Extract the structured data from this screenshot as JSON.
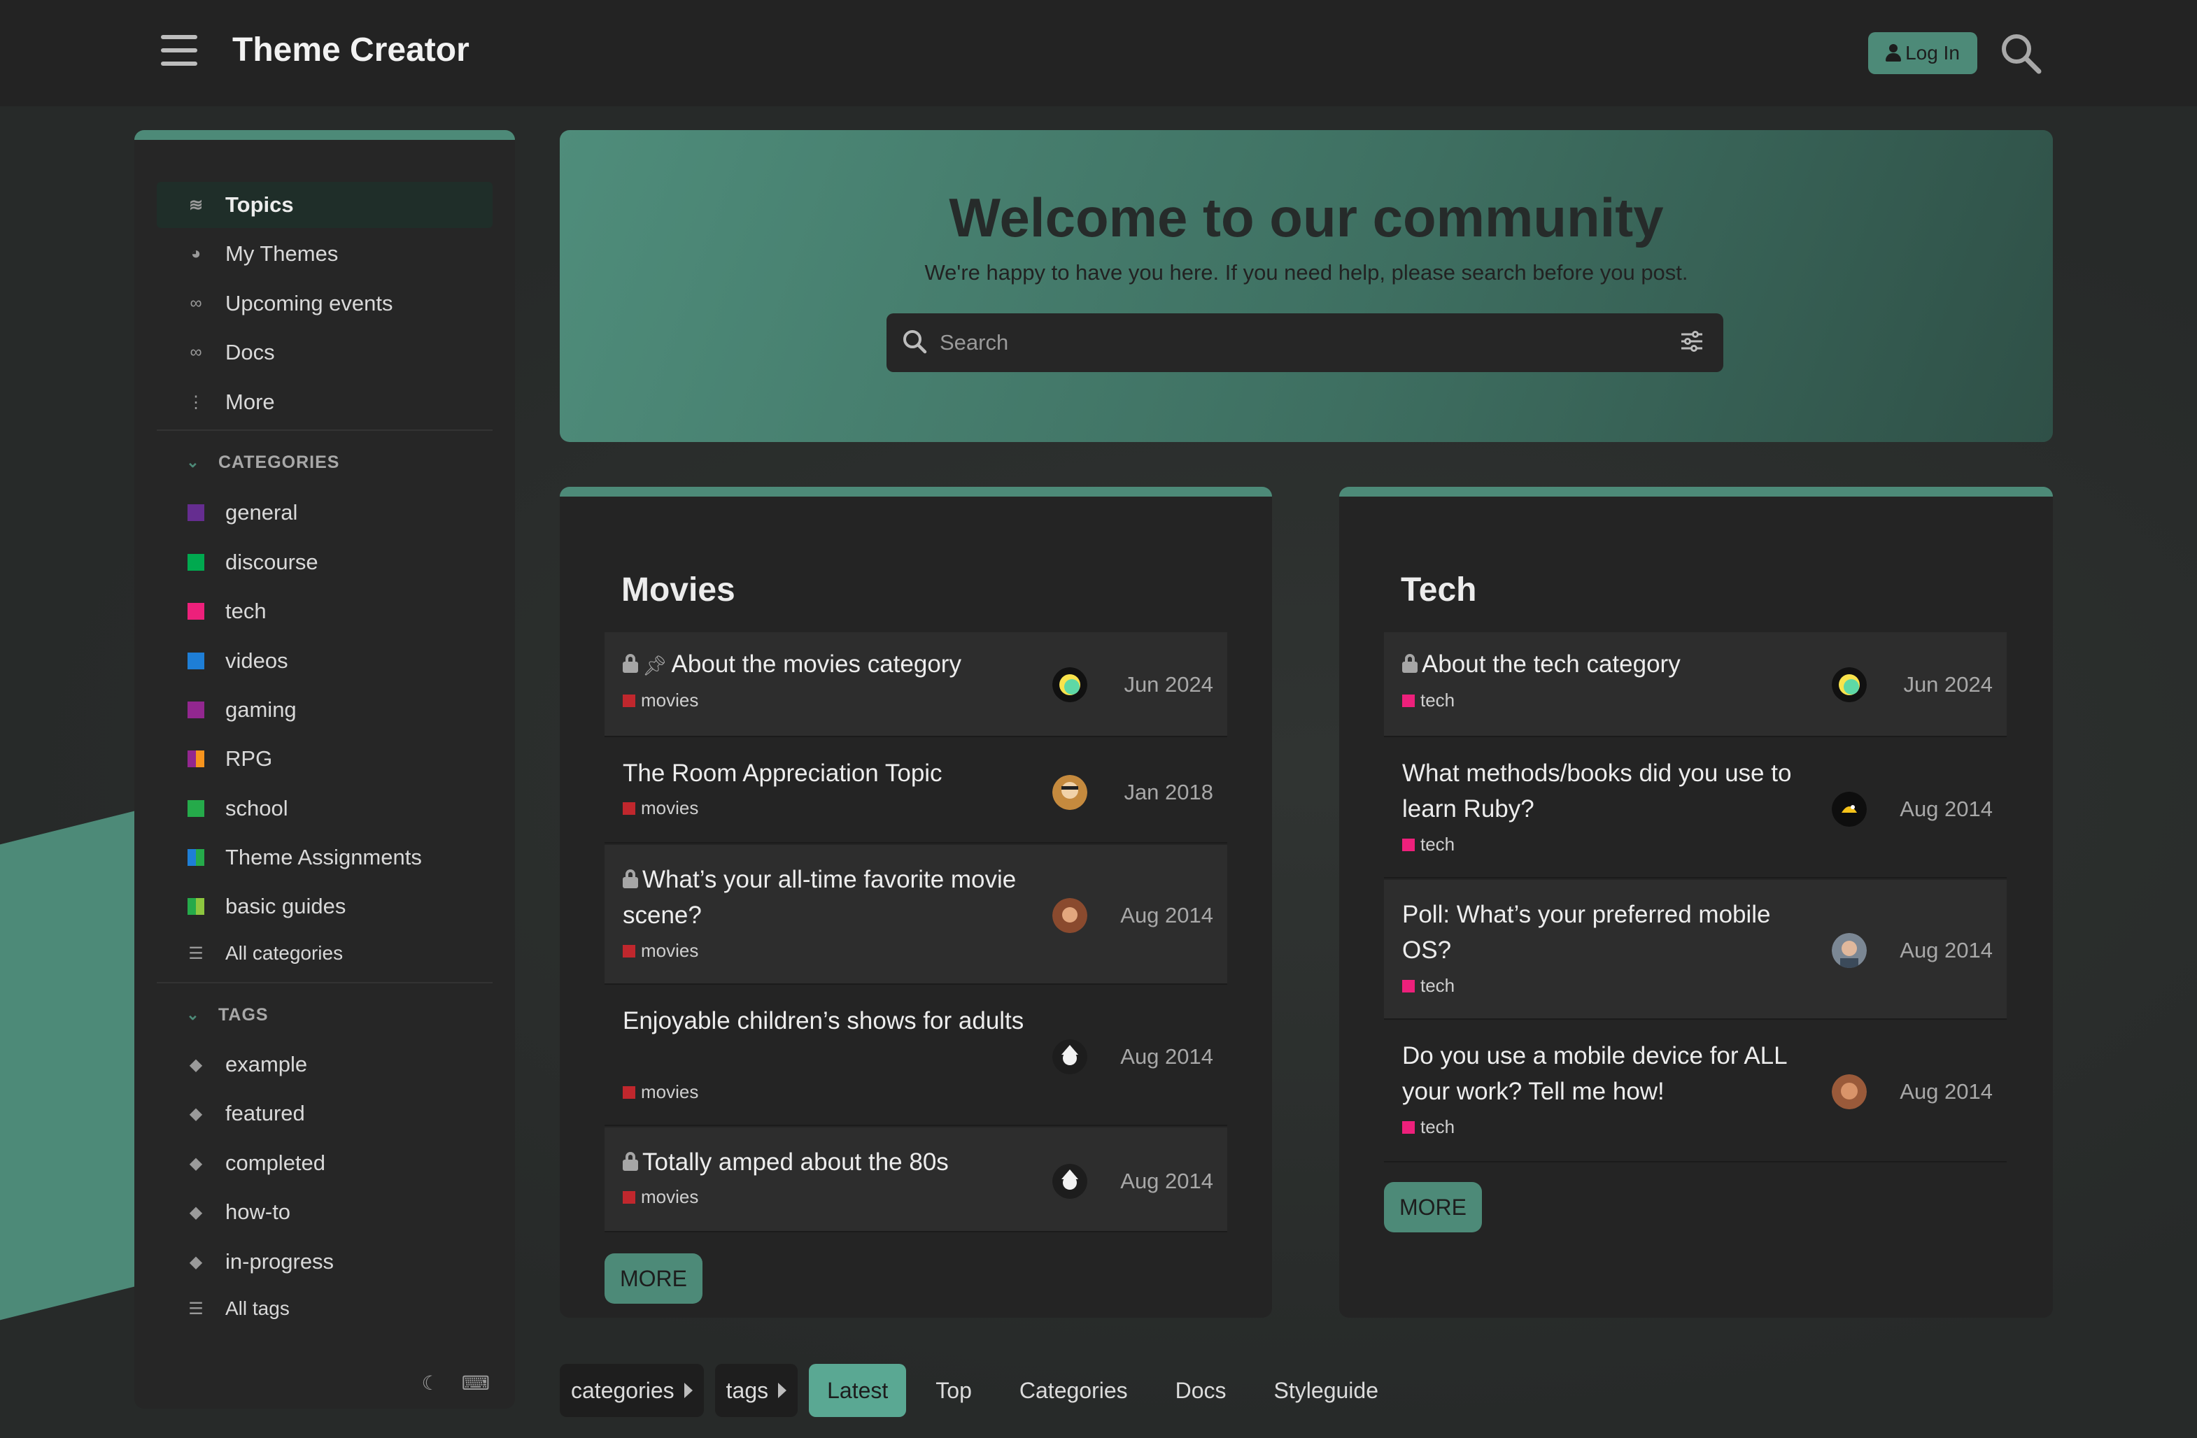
{
  "header": {
    "site_title": "Theme Creator",
    "login_label": "Log In"
  },
  "sidebar": {
    "nav": [
      {
        "label": "Topics",
        "icon": "layers-icon",
        "active": true
      },
      {
        "label": "My Themes",
        "icon": "palette-icon"
      },
      {
        "label": "Upcoming events",
        "icon": "link-icon"
      },
      {
        "label": "Docs",
        "icon": "link-icon"
      },
      {
        "label": "More",
        "icon": "ellipsis-vertical-icon"
      }
    ],
    "categories_heading": "CATEGORIES",
    "categories": [
      {
        "label": "general",
        "color": "#652d90"
      },
      {
        "label": "discourse",
        "color": "#00a94f"
      },
      {
        "label": "tech",
        "color": "#ed207b"
      },
      {
        "label": "videos",
        "color": "#1e7ed6"
      },
      {
        "label": "gaming",
        "color": "#92278f"
      },
      {
        "label": "RPG",
        "colors": [
          "#92278f",
          "#f7941d"
        ]
      },
      {
        "label": "school",
        "color": "#25aa4a"
      },
      {
        "label": "Theme Assignments",
        "colors": [
          "#1e7ed6",
          "#25aa4a"
        ]
      },
      {
        "label": "basic guides",
        "colors": [
          "#25aa4a",
          "#8dc63f"
        ]
      }
    ],
    "all_categories_label": "All categories",
    "tags_heading": "TAGS",
    "tags": [
      "example",
      "featured",
      "completed",
      "how-to",
      "in-progress"
    ],
    "all_tags_label": "All tags"
  },
  "banner": {
    "title": "Welcome to our community",
    "subtitle": "We're happy to have you here. If you need help, please search before you post.",
    "search_placeholder": "Search"
  },
  "cards": {
    "movies": {
      "title": "Movies",
      "category_color": "#c0272d",
      "topics": [
        {
          "title": "About the movies category",
          "category": "movies",
          "date": "Jun 2024",
          "locked": true,
          "pinned": true
        },
        {
          "title": "The Room Appreciation Topic",
          "category": "movies",
          "date": "Jan 2018"
        },
        {
          "title": "What’s your all-time favorite movie scene?",
          "category": "movies",
          "date": "Aug 2014",
          "locked": true
        },
        {
          "title": "Enjoyable children’s shows for adults",
          "category": "movies",
          "date": "Aug 2014"
        },
        {
          "title": "Totally amped about the 80s",
          "category": "movies",
          "date": "Aug 2014",
          "locked": true
        }
      ],
      "more_label": "MORE"
    },
    "tech": {
      "title": "Tech",
      "category_color": "#ed207b",
      "topics": [
        {
          "title": "About the tech category",
          "category": "tech",
          "date": "Jun 2024",
          "locked": true
        },
        {
          "title": "What methods/books did you use to learn Ruby?",
          "category": "tech",
          "date": "Aug 2014"
        },
        {
          "title": "Poll: What’s your preferred mobile OS?",
          "category": "tech",
          "date": "Aug 2014"
        },
        {
          "title": "Do you use a mobile device for ALL your work? Tell me how!",
          "category": "tech",
          "date": "Aug 2014"
        }
      ],
      "more_label": "MORE"
    }
  },
  "bottom_nav": {
    "categories_label": "categories",
    "tags_label": "tags",
    "items": [
      "Latest",
      "Top",
      "Categories",
      "Docs",
      "Styleguide"
    ],
    "active": "Latest"
  },
  "colors": {
    "accent": "#4d8a78",
    "header_bg": "#232323",
    "page_bg": "#2b2f2d"
  }
}
